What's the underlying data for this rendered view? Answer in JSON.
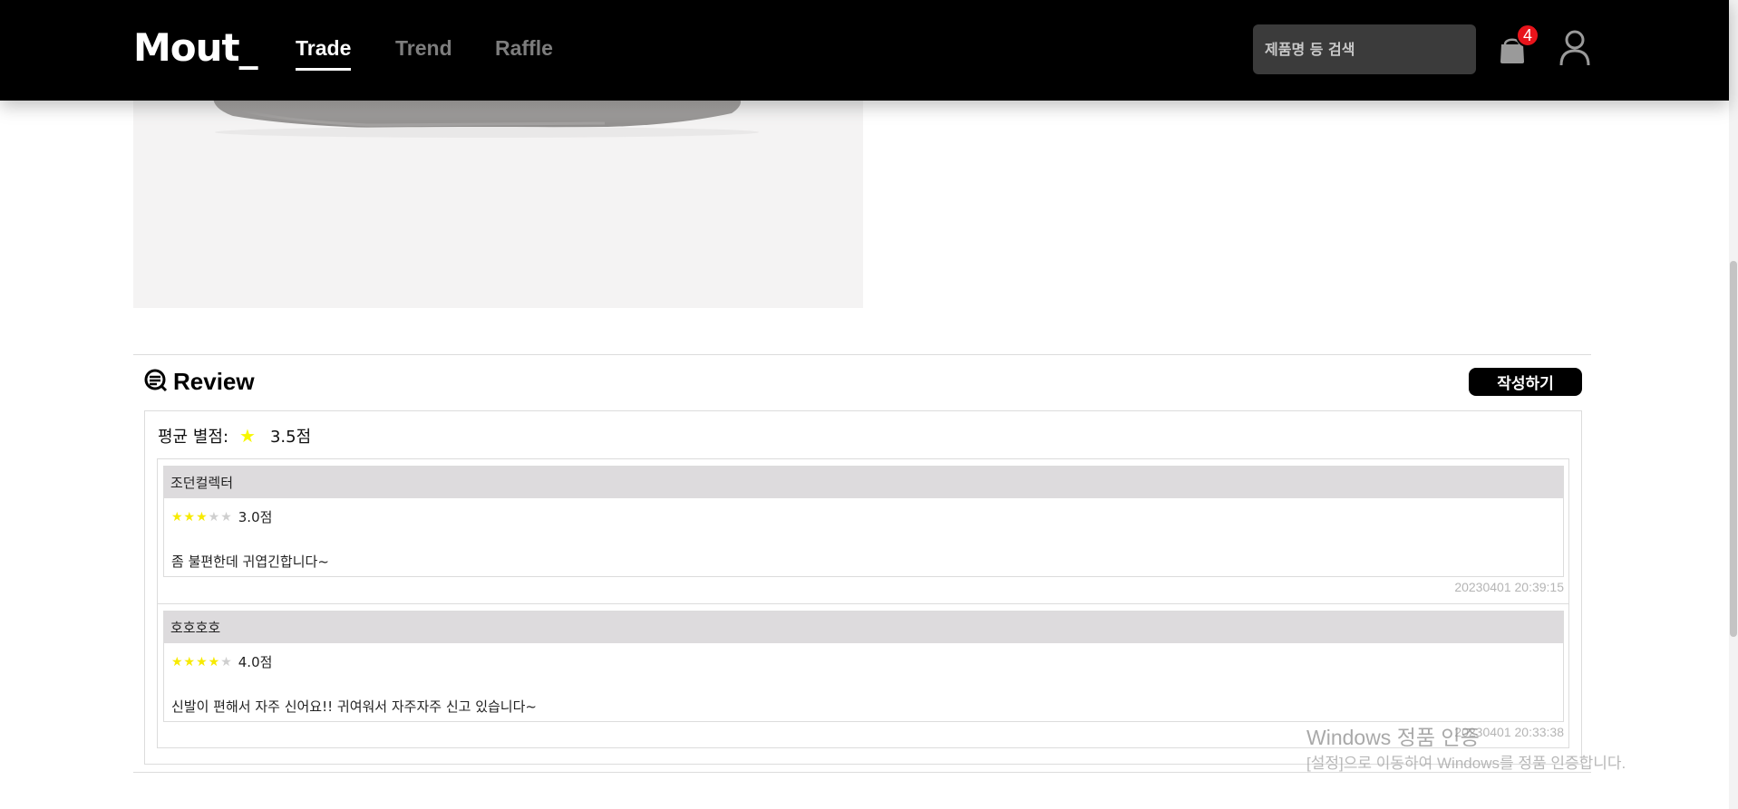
{
  "header": {
    "logo": "Mout_",
    "nav": [
      {
        "label": "Trade",
        "active": true
      },
      {
        "label": "Trend",
        "active": false
      },
      {
        "label": "Raffle",
        "active": false
      }
    ],
    "search_placeholder": "제품명 등 검색",
    "cart_count": "4",
    "icons": {
      "cart": "shopping-bag-icon",
      "user": "user-icon"
    }
  },
  "review": {
    "title": "Review",
    "write_label": "작성하기",
    "average_label": "평균 별점:",
    "average_value": "3.5점",
    "items": [
      {
        "author": "조던컬렉터",
        "rating": 3,
        "rating_text": "3.0점",
        "body": "좀 불편한데 귀엽긴합니다~",
        "date": "20230401 20:39:15"
      },
      {
        "author": "호호호호",
        "rating": 4,
        "rating_text": "4.0점",
        "body": "신발이 편해서 자주 신어요!! 귀여워서 자주자주 신고 있습니다~",
        "date": "20230401 20:33:38"
      }
    ]
  },
  "watermark": {
    "line1": "Windows 정품 인증",
    "line2": "[설정]으로 이동하여 Windows를 정품 인증합니다."
  },
  "colors": {
    "header_bg": "#000000",
    "badge": "#e8141b",
    "star": "#f7ea00",
    "author_bar": "#dddbdd"
  }
}
